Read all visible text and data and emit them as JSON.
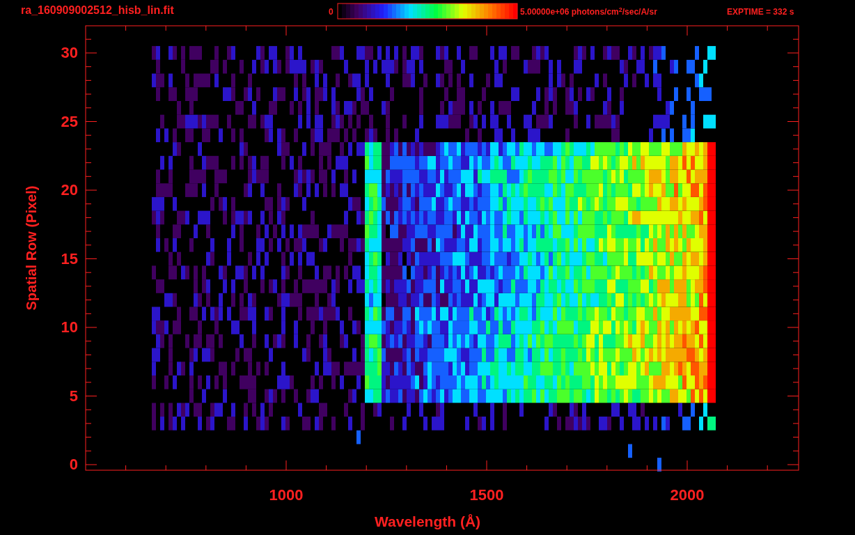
{
  "title": "ra_160909002512_hisb_lin.fit",
  "colorbar": {
    "min_label": "0",
    "max_label": "5.00000e+06 photons/cm$^{2}$/sec/A/sr"
  },
  "exposure": "EXPTIME = 332 s",
  "x_axis": {
    "title": "Wavelength (Å)",
    "tick_labels": [
      "1000",
      "1500",
      "2000"
    ]
  },
  "y_axis": {
    "title": "Spatial Row (Pixel)",
    "tick_labels": [
      "30",
      "25",
      "20",
      "15",
      "10",
      "5",
      "0"
    ]
  }
}
